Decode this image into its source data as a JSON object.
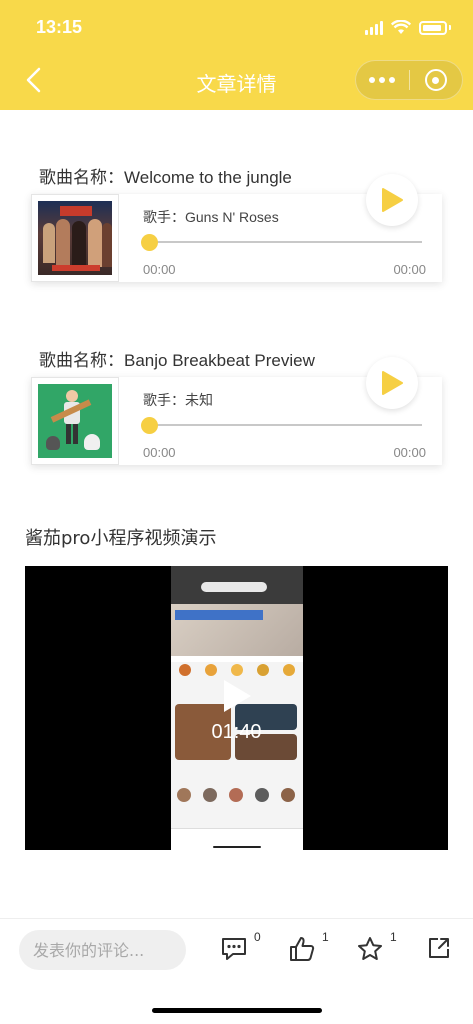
{
  "status_bar": {
    "time": "13:15"
  },
  "nav": {
    "title": "文章详情"
  },
  "songs": [
    {
      "title": "歌曲名称：Welcome to the jungle",
      "singer": "歌手：Guns N' Roses",
      "current_time": "00:00",
      "total_time": "00:00",
      "progress": 0
    },
    {
      "title": "歌曲名称：Banjo Breakbeat Preview",
      "singer": "歌手：未知",
      "current_time": "00:00",
      "total_time": "00:00",
      "progress": 0
    }
  ],
  "video": {
    "section_title": "酱茄pro小程序视频演示",
    "duration": "01:40"
  },
  "bottom_bar": {
    "comment_placeholder": "发表你的评论...",
    "comment_count": "0",
    "like_count": "1",
    "favorite_count": "1"
  },
  "colors": {
    "accent": "#F8D94A",
    "play": "#F6CF43"
  },
  "icons": [
    "back-arrow-icon",
    "more-dots-icon",
    "close-circle-icon",
    "play-icon",
    "comment-icon",
    "thumbs-up-icon",
    "star-icon",
    "share-icon"
  ]
}
